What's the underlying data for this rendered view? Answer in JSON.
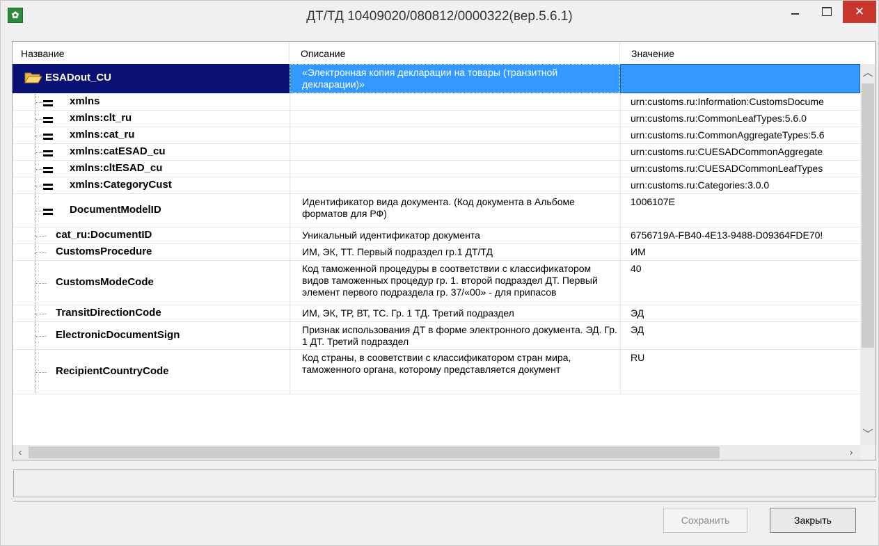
{
  "window": {
    "title": "ДТ/ТД 10409020/080812/0000322(вер.5.6.1)",
    "icon": "app-logo-icon",
    "controls": [
      "minimize-icon",
      "maximize-icon",
      "close-icon"
    ]
  },
  "grid": {
    "columns": [
      "Название",
      "Описание",
      "Значение"
    ],
    "root": {
      "name": "ESADout_CU",
      "icon": "folder-open-icon",
      "description": "«Электронная копия декларации на товары (транзитной декларации)»",
      "value": ""
    },
    "rows": [
      {
        "name": "xmlns",
        "icon": "attribute-icon",
        "description": "",
        "value": "urn:customs.ru:Information:CustomsDocume"
      },
      {
        "name": "xmlns:clt_ru",
        "icon": "attribute-icon",
        "description": "",
        "value": "urn:customs.ru:CommonLeafTypes:5.6.0"
      },
      {
        "name": "xmlns:cat_ru",
        "icon": "attribute-icon",
        "description": "",
        "value": "urn:customs.ru:CommonAggregateTypes:5.6"
      },
      {
        "name": "xmlns:catESAD_cu",
        "icon": "attribute-icon",
        "description": "",
        "value": "urn:customs.ru:CUESADCommonAggregate"
      },
      {
        "name": "xmlns:cltESAD_cu",
        "icon": "attribute-icon",
        "description": "",
        "value": "urn:customs.ru:CUESADCommonLeafTypes"
      },
      {
        "name": "xmlns:CategoryCust",
        "icon": "attribute-icon",
        "description": "",
        "value": "urn:customs.ru:Categories:3.0.0"
      },
      {
        "name": "DocumentModelID",
        "icon": "attribute-icon",
        "description": "Идентификатор вида документа. (Код документа в Альбоме форматов для РФ)",
        "value": "1006107E"
      },
      {
        "name": "cat_ru:DocumentID",
        "icon": "",
        "description": "Уникальный идентификатор документа",
        "value": "6756719A-FB40-4E13-9488-D09364FDE70!"
      },
      {
        "name": "CustomsProcedure",
        "icon": "",
        "description": "ИМ, ЭК, ТТ. Первый подраздел гр.1 ДТ/ТД",
        "value": "ИМ"
      },
      {
        "name": "CustomsModeCode",
        "icon": "",
        "description": "Код таможенной процедуры в соответствии с классификатором видов таможенных процедур гр. 1. второй подраздел ДТ. Первый элемент первого подраздела гр. 37/«00» - для припасов",
        "value": "40"
      },
      {
        "name": "TransitDirectionCode",
        "icon": "",
        "description": " ИМ, ЭК, ТР, ВТ, ТС. Гр. 1 ТД. Третий подраздел",
        "value": "ЭД"
      },
      {
        "name": "ElectronicDocumentSign",
        "icon": "",
        "description": "Признак использования ДТ в форме электронного документа. ЭД. Гр. 1 ДТ. Третий подраздел",
        "value": "ЭД"
      },
      {
        "name": "RecipientCountryCode",
        "icon": "",
        "description": "Код страны, в сооветствии с классификатором стран мира, таможенного органа, которому представляется документ",
        "value": "RU"
      }
    ],
    "scroll": {
      "up": "chevron-up-icon",
      "down": "chevron-down-icon",
      "left": "chevron-left-icon",
      "right": "chevron-right-icon"
    }
  },
  "buttons": {
    "save": "Сохранить",
    "close": "Закрыть"
  },
  "colors": {
    "selection_name_bg": "#0a1173",
    "selection_bg": "#3399ff",
    "close_button_bg": "#c8362d"
  }
}
